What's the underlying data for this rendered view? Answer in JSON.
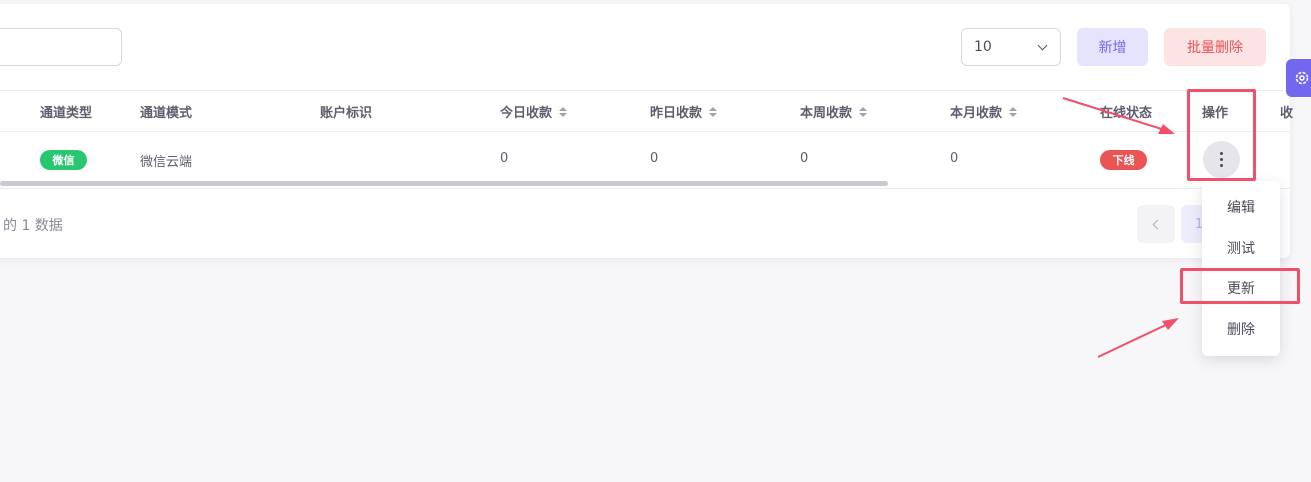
{
  "toolbar": {
    "page_size": "10",
    "add_label": "新增",
    "batch_delete_label": "批量删除"
  },
  "table": {
    "columns": [
      "通道类型",
      "通道模式",
      "账户标识",
      "今日收款",
      "昨日收款",
      "本周收款",
      "本月收款",
      "在线状态",
      "操作",
      "收"
    ],
    "rows": [
      {
        "channel_type": "微信",
        "channel_mode": "微信云端",
        "account_id": "",
        "today": "0",
        "yesterday": "0",
        "this_week": "0",
        "this_month": "0",
        "status": "下线"
      }
    ]
  },
  "footer": {
    "summary": "的 1 数据",
    "current_page": "1"
  },
  "action_menu": {
    "items": [
      "编辑",
      "测试",
      "更新",
      "删除"
    ]
  },
  "colors": {
    "primary": "#7367f0",
    "danger": "#ea5455",
    "success": "#28c76f",
    "annotation": "#f0506a"
  }
}
